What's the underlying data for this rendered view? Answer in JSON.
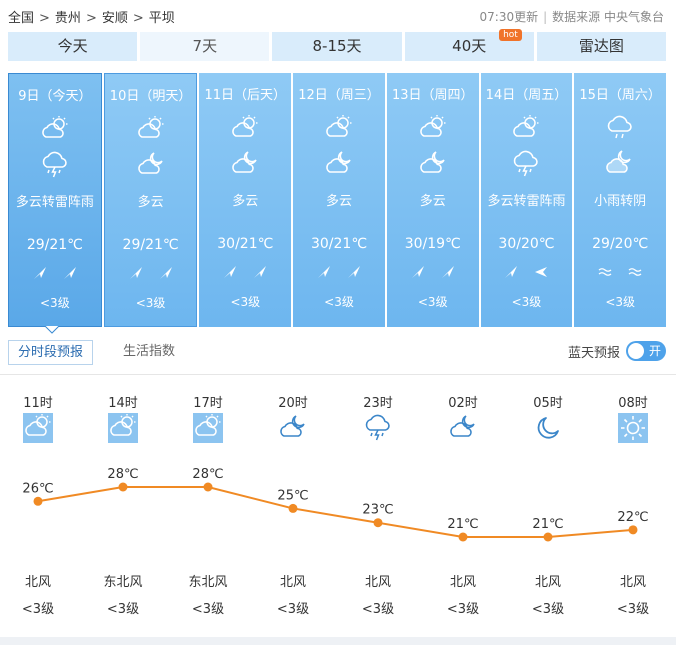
{
  "breadcrumb": [
    "全国",
    "贵州",
    "安顺",
    "平坝"
  ],
  "breadcrumb_sep": ">",
  "update_time": "07:30更新",
  "source": "数据来源 中央气象台",
  "tabs": [
    {
      "label": "今天"
    },
    {
      "label": "7天",
      "active": true
    },
    {
      "label": "8-15天"
    },
    {
      "label": "40天",
      "badge": "hot"
    },
    {
      "label": "雷达图"
    }
  ],
  "days": [
    {
      "date": "9日（今天）",
      "icon1": "partly-cloudy-sun-icon",
      "icon2": "thunder-shower-icon",
      "desc": "多云转雷阵雨",
      "temp": "29/21℃",
      "wind": [
        "arrow",
        "arrow"
      ],
      "level": "<3级"
    },
    {
      "date": "10日（明天）",
      "icon1": "partly-cloudy-sun-icon",
      "icon2": "partly-cloudy-moon-icon",
      "desc": "多云",
      "temp": "29/21℃",
      "wind": [
        "arrow",
        "arrow"
      ],
      "level": "<3级"
    },
    {
      "date": "11日（后天）",
      "icon1": "partly-cloudy-sun-icon",
      "icon2": "partly-cloudy-moon-icon",
      "desc": "多云",
      "temp": "30/21℃",
      "wind": [
        "arrow",
        "arrow"
      ],
      "level": "<3级"
    },
    {
      "date": "12日（周三）",
      "icon1": "partly-cloudy-sun-icon",
      "icon2": "partly-cloudy-moon-icon",
      "desc": "多云",
      "temp": "30/21℃",
      "wind": [
        "arrow",
        "arrow"
      ],
      "level": "<3级"
    },
    {
      "date": "13日（周四）",
      "icon1": "partly-cloudy-sun-icon",
      "icon2": "partly-cloudy-moon-icon",
      "desc": "多云",
      "temp": "30/19℃",
      "wind": [
        "arrow",
        "arrow"
      ],
      "level": "<3级"
    },
    {
      "date": "14日（周五）",
      "icon1": "partly-cloudy-sun-icon",
      "icon2": "thunder-shower-icon",
      "desc": "多云转雷阵雨",
      "temp": "30/20℃",
      "wind": [
        "arrow",
        "arrow-left"
      ],
      "level": "<3级"
    },
    {
      "date": "15日（周六）",
      "icon1": "light-rain-icon",
      "icon2": "cloudy-moon-icon",
      "desc": "小雨转阴",
      "temp": "29/20℃",
      "wind": [
        "wave",
        "wave"
      ],
      "level": "<3级"
    }
  ],
  "subtabs": {
    "hourly": "分时段预报",
    "life": "生活指数"
  },
  "toggle": {
    "label": "蓝天预报",
    "state": "开"
  },
  "hourly": [
    {
      "time": "11时",
      "icon": "partly-cloudy-sun-icon",
      "temp": 26,
      "temp_label": "26℃",
      "wind_dir": "北风",
      "wind_level": "<3级"
    },
    {
      "time": "14时",
      "icon": "partly-cloudy-sun-icon",
      "temp": 28,
      "temp_label": "28℃",
      "wind_dir": "东北风",
      "wind_level": "<3级"
    },
    {
      "time": "17时",
      "icon": "partly-cloudy-sun-icon",
      "temp": 28,
      "temp_label": "28℃",
      "wind_dir": "东北风",
      "wind_level": "<3级"
    },
    {
      "time": "20时",
      "icon": "partly-cloudy-moon-icon",
      "temp": 25,
      "temp_label": "25℃",
      "wind_dir": "北风",
      "wind_level": "<3级"
    },
    {
      "time": "23时",
      "icon": "thunder-shower-icon",
      "temp": 23,
      "temp_label": "23℃",
      "wind_dir": "北风",
      "wind_level": "<3级"
    },
    {
      "time": "02时",
      "icon": "partly-cloudy-moon-icon",
      "temp": 21,
      "temp_label": "21℃",
      "wind_dir": "北风",
      "wind_level": "<3级"
    },
    {
      "time": "05时",
      "icon": "crescent-moon-icon",
      "temp": 21,
      "temp_label": "21℃",
      "wind_dir": "北风",
      "wind_level": "<3级"
    },
    {
      "time": "08时",
      "icon": "sun-icon",
      "temp": 22,
      "temp_label": "22℃",
      "wind_dir": "北风",
      "wind_level": "<3级"
    }
  ],
  "colors": {
    "accent": "#4ea2ea",
    "curve": "#f08a24",
    "card": "#7ab9ee"
  }
}
